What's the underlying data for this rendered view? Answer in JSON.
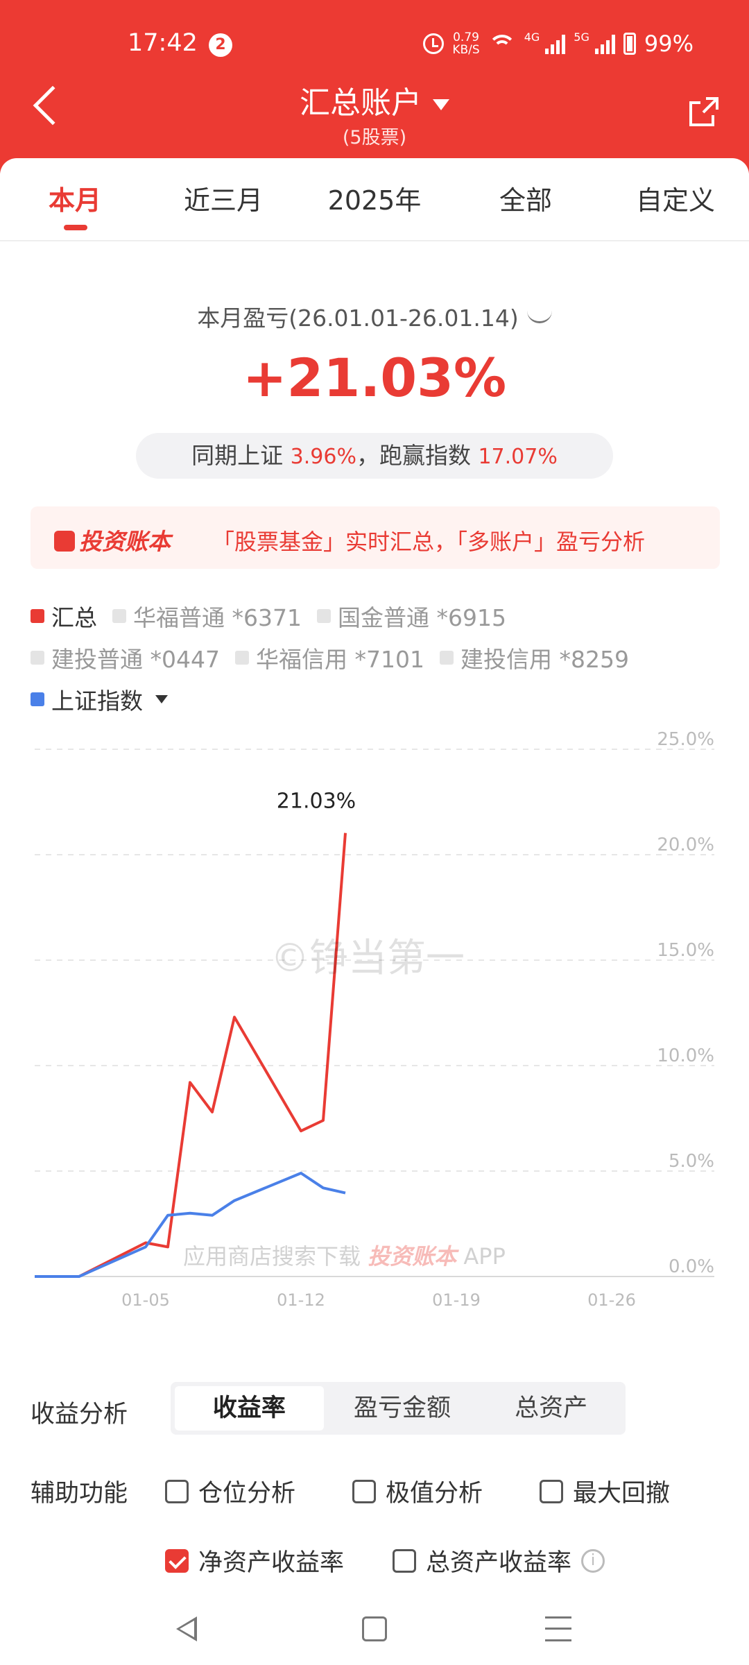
{
  "status": {
    "time": "17:42",
    "notif_count": "2",
    "net_speed_top": "0.79",
    "net_speed_unit": "KB/S",
    "net1": "4G",
    "net2": "5G",
    "battery": "99%"
  },
  "header": {
    "title": "汇总账户",
    "subtitle": "(5股票)"
  },
  "tabs": [
    {
      "label": "本月"
    },
    {
      "label": "近三月"
    },
    {
      "label": "2025年"
    },
    {
      "label": "全部"
    },
    {
      "label": "自定义"
    }
  ],
  "summary": {
    "period": "本月盈亏(26.01.01-26.01.14)",
    "profit_pct": "+21.03%",
    "compare_prefix": "同期上证",
    "index_pct": "3.96%",
    "compare_mid": "，跑赢指数",
    "beat_pct": "17.07%"
  },
  "banner": {
    "logo": "投资账本",
    "text": "「股票基金」实时汇总，「多账户」盈亏分析"
  },
  "legend": [
    {
      "label": "汇总",
      "on": true,
      "color": "#e93b34"
    },
    {
      "label": "华福普通 *6371",
      "on": false
    },
    {
      "label": "国金普通 *6915",
      "on": false
    },
    {
      "label": "建投普通 *0447",
      "on": false
    },
    {
      "label": "华福信用 *7101",
      "on": false
    },
    {
      "label": "建投信用 *8259",
      "on": false
    },
    {
      "label": "上证指数",
      "on": true,
      "color": "#4a80e8"
    }
  ],
  "watermark": "©铮当第一",
  "watermark2_prefix": "应用商店搜索下载",
  "watermark2_logo": "投资账本",
  "watermark2_suffix": "APP",
  "chart_data": {
    "type": "line",
    "y_ticks": [
      "25.0%",
      "20.0%",
      "15.0%",
      "10.0%",
      "5.0%",
      "0.0%"
    ],
    "ylim": [
      0,
      25
    ],
    "x_ticks": [
      "01-05",
      "01-12",
      "01-19",
      "01-26"
    ],
    "x_tick_days": [
      5,
      12,
      19,
      26
    ],
    "xlim": [
      0,
      31
    ],
    "peak_label": "21.03%",
    "series": [
      {
        "name": "汇总",
        "color": "#e93b34",
        "points": [
          [
            0,
            0
          ],
          [
            1,
            0
          ],
          [
            2,
            0
          ],
          [
            5,
            1.6
          ],
          [
            6,
            1.4
          ],
          [
            7,
            9.2
          ],
          [
            8,
            7.8
          ],
          [
            9,
            12.3
          ],
          [
            12,
            6.9
          ],
          [
            13,
            7.4
          ],
          [
            14,
            21.03
          ]
        ]
      },
      {
        "name": "上证指数",
        "color": "#4a80e8",
        "points": [
          [
            0,
            0
          ],
          [
            1,
            0
          ],
          [
            2,
            0
          ],
          [
            5,
            1.4
          ],
          [
            6,
            2.9
          ],
          [
            7,
            3.0
          ],
          [
            8,
            2.9
          ],
          [
            9,
            3.6
          ],
          [
            12,
            4.9
          ],
          [
            13,
            4.2
          ],
          [
            14,
            3.96
          ]
        ]
      }
    ]
  },
  "analysis": {
    "label": "收益分析",
    "options": [
      "收益率",
      "盈亏金额",
      "总资产"
    ]
  },
  "aux": {
    "label": "辅助功能",
    "options": [
      {
        "label": "仓位分析",
        "checked": false
      },
      {
        "label": "极值分析",
        "checked": false
      },
      {
        "label": "最大回撤",
        "checked": false
      },
      {
        "label": "净资产收益率",
        "checked": true
      },
      {
        "label": "总资产收益率",
        "checked": false
      }
    ]
  },
  "info_icon": "i"
}
